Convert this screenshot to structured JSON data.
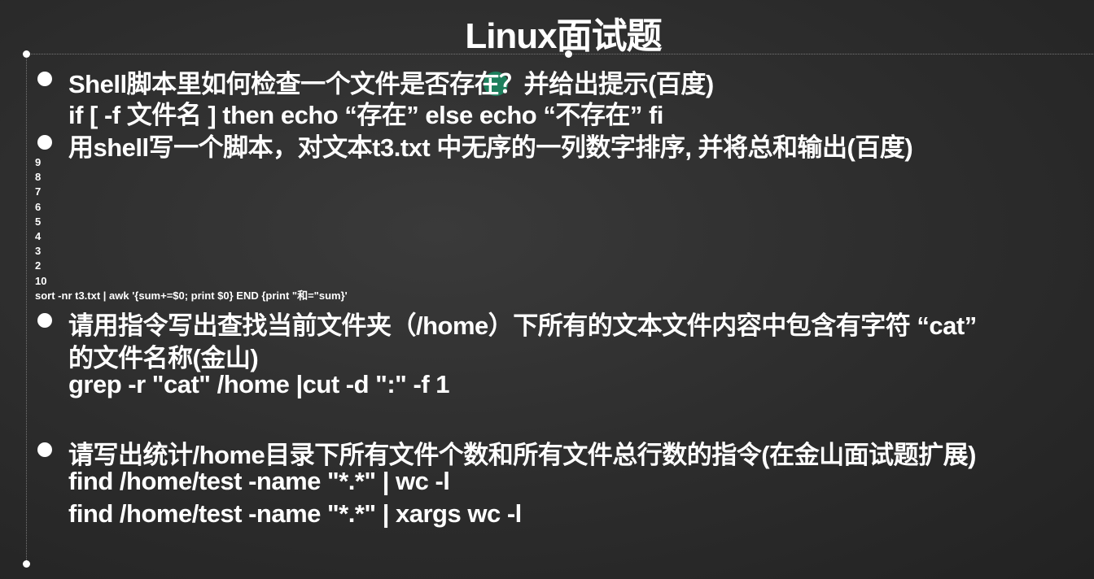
{
  "title": "Linux面试题",
  "q1": {
    "question": "Shell脚本里如何检查一个文件是否存在？并给出提示(百度)",
    "answer": "if [ -f 文件名 ]  then echo “存在” else echo “不存在” fi"
  },
  "q2": {
    "question": "用shell写一个脚本，对文本t3.txt 中无序的一列数字排序, 并将总和输出(百度)",
    "numbers": [
      "9",
      "8",
      "7",
      "6",
      "5",
      "4",
      "3",
      "2",
      "10"
    ],
    "answer": "sort -nr t3.txt  | awk '{sum+=$0; print $0} END {print \"和=\"sum}'"
  },
  "q3": {
    "question": "请用指令写出查找当前文件夹（/home）下所有的文本文件内容中包含有字符 “cat”",
    "question_line2": "的文件名称(金山)",
    "answer": "grep -r \"cat\" /home |cut -d \":\" -f 1"
  },
  "q4": {
    "question": "请写出统计/home目录下所有文件个数和所有文件总行数的指令(在金山面试题扩展)",
    "answer1": "find /home/test -name \"*.*\"  | wc -l",
    "answer2": "find /home/test -name \"*.*\"  | xargs wc -l"
  }
}
